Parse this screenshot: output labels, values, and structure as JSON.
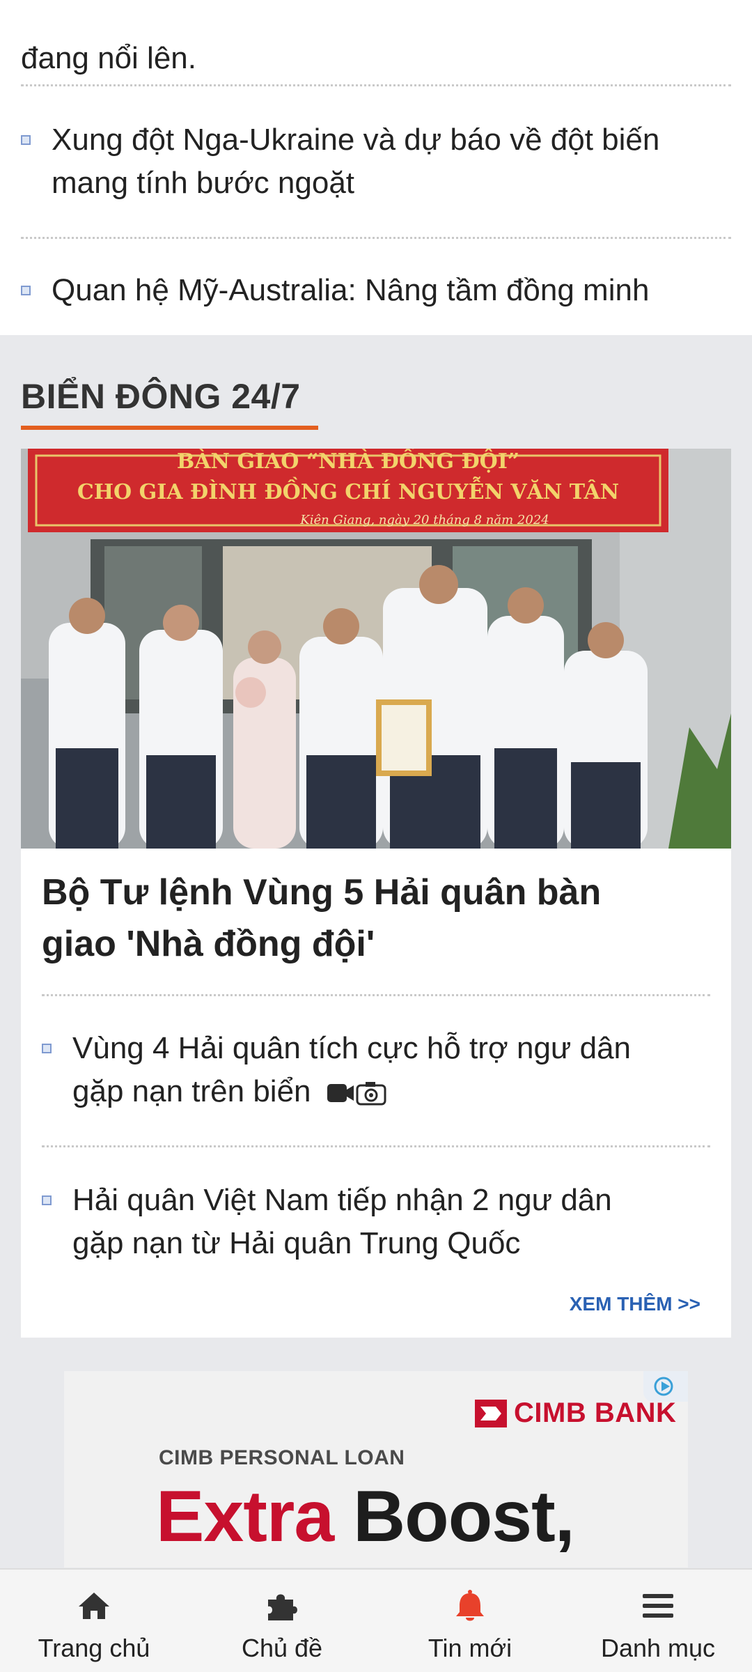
{
  "top_list": {
    "cut_line_end": "đang nổi lên.",
    "items": [
      {
        "line1": "Xung đột Nga-Ukraine và dự báo về đột biến",
        "line2": "mang tính bước ngoặt"
      },
      {
        "line1": "Quan hệ Mỹ-Australia: Nâng tầm đồng minh",
        "line2": ""
      }
    ]
  },
  "section": {
    "title": "BIỂN ĐÔNG 24/7",
    "accent_color": "#e35f1f",
    "photo": {
      "banner_line1": "BÀN GIAO “NHÀ ĐỒNG ĐỘI”",
      "banner_line2": "CHO GIA ĐÌNH ĐỒNG CHÍ NGUYỄN VĂN TÂN",
      "banner_line3": "Kiên Giang, ngày 20 tháng 8 năm 2024"
    },
    "headline_line1": "Bộ Tư lệnh Vùng 5 Hải quân bàn",
    "headline_line2": "giao 'Nhà đồng đội'",
    "items": [
      {
        "line1": "Vùng 4 Hải quân tích cực hỗ trợ ngư dân",
        "line2": "gặp nạn trên biển",
        "icons": [
          "video-icon",
          "camera-icon"
        ]
      },
      {
        "line1": "Hải quân Việt Nam tiếp nhận 2 ngư dân",
        "line2": "gặp nạn từ Hải quân Trung Quốc"
      }
    ],
    "see_more": "XEM THÊM >>"
  },
  "ad": {
    "brand": "CIMB BANK",
    "subtitle": "CIMB PERSONAL LOAN",
    "headline_red": "Extra",
    "headline_dark": "Boost,",
    "brand_color": "#c7102e"
  },
  "bottom_nav": {
    "items": [
      {
        "label": "Trang chủ",
        "icon": "home-icon"
      },
      {
        "label": "Chủ đề",
        "icon": "puzzle-icon"
      },
      {
        "label": "Tin mới",
        "icon": "bell-icon"
      },
      {
        "label": "Danh mục",
        "icon": "menu-icon"
      }
    ],
    "active_color": "#e8412b"
  }
}
